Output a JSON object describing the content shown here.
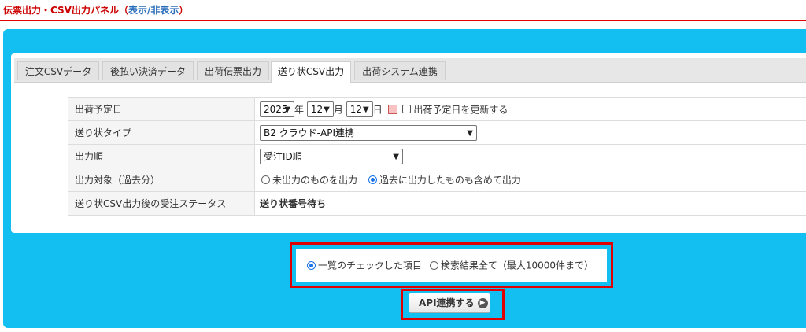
{
  "header": {
    "title": "伝票出力・CSV出力パネル（",
    "toggle_link": "表示/非表示",
    "close_paren": "）"
  },
  "tabs": [
    {
      "label": "注文CSVデータ"
    },
    {
      "label": "後払い決済データ"
    },
    {
      "label": "出荷伝票出力"
    },
    {
      "label": "送り状CSV出力",
      "active": true
    },
    {
      "label": "出荷システム連携"
    }
  ],
  "form": {
    "ship_date": {
      "label": "出荷予定日",
      "year": "2025",
      "year_suffix": "年",
      "month": "12",
      "month_suffix": "月",
      "day": "12",
      "day_suffix": "日",
      "update_checkbox_label": "出荷予定日を更新する",
      "update_checked": false
    },
    "invoice_type": {
      "label": "送り状タイプ",
      "value": "B2 クラウド-API連携"
    },
    "output_order": {
      "label": "出力順",
      "value": "受注ID順"
    },
    "output_target": {
      "label": "出力対象（過去分）",
      "option_unoutput": "未出力のものを出力",
      "option_include_past": "過去に出力したものも含めて出力",
      "selected": "option_include_past"
    },
    "status_after": {
      "label": "送り状CSV出力後の受注ステータス",
      "value": "送り状番号待ち"
    }
  },
  "scope": {
    "option_checked_items": "一覧のチェックした項目",
    "option_all_results": "検索結果全て（最大10000件まで）",
    "selected": "option_checked_items"
  },
  "action_button": {
    "label": "API連携する"
  },
  "colors": {
    "panel_blue": "#12bff0",
    "header_red": "#cc0000",
    "highlight_red": "#e00000",
    "link_blue": "#2a6ebb",
    "radio_blue": "#1a73e8"
  },
  "icons": {
    "calendar": "calendar-icon",
    "dropdown": "chevron-down-icon",
    "button_arrow": "arrow-right-circle-icon"
  }
}
